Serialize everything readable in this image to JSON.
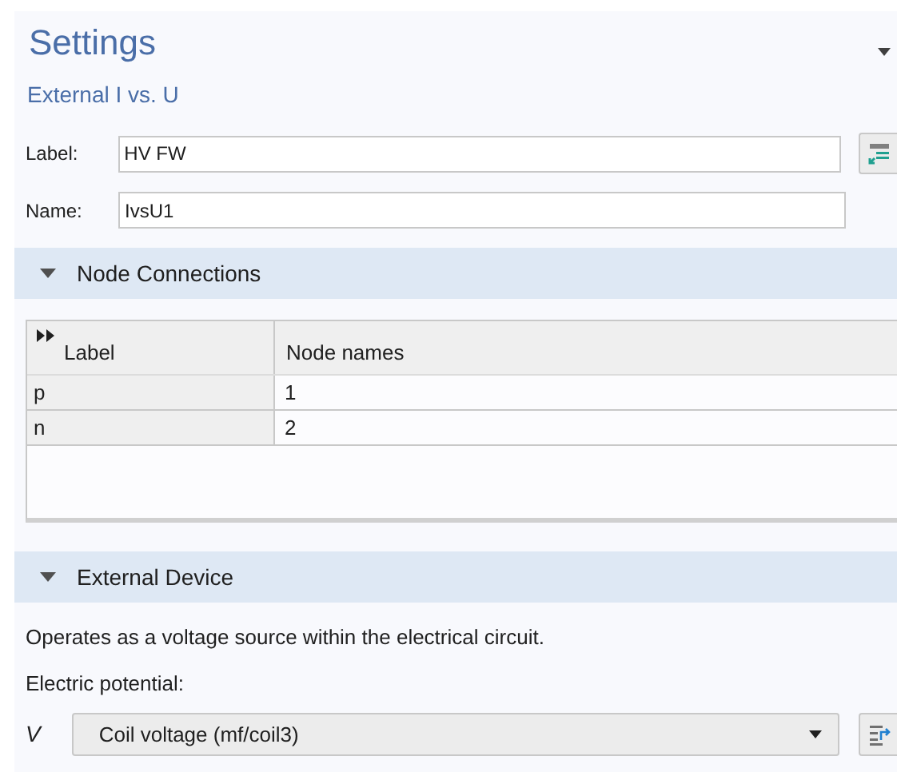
{
  "header": {
    "title": "Settings",
    "subtitle": "External I vs. U"
  },
  "fields": [
    {
      "label": "Label:",
      "value": "HV FW",
      "has_button": true
    },
    {
      "label": "Name:",
      "value": "IvsU1",
      "has_button": false
    }
  ],
  "sections": [
    {
      "title": "Node Connections",
      "expanded": true,
      "kind": "table",
      "table": {
        "columns": [
          "Label",
          "Node names"
        ],
        "rows": [
          [
            "p",
            "1"
          ],
          [
            "n",
            "2"
          ]
        ]
      }
    },
    {
      "title": "External Device",
      "expanded": true,
      "kind": "device",
      "description": "Operates as a voltage source within the electrical circuit.",
      "potential_label": "Electric potential:",
      "symbol": "V",
      "select_value": "Coil voltage (mf/coil3)"
    }
  ]
}
